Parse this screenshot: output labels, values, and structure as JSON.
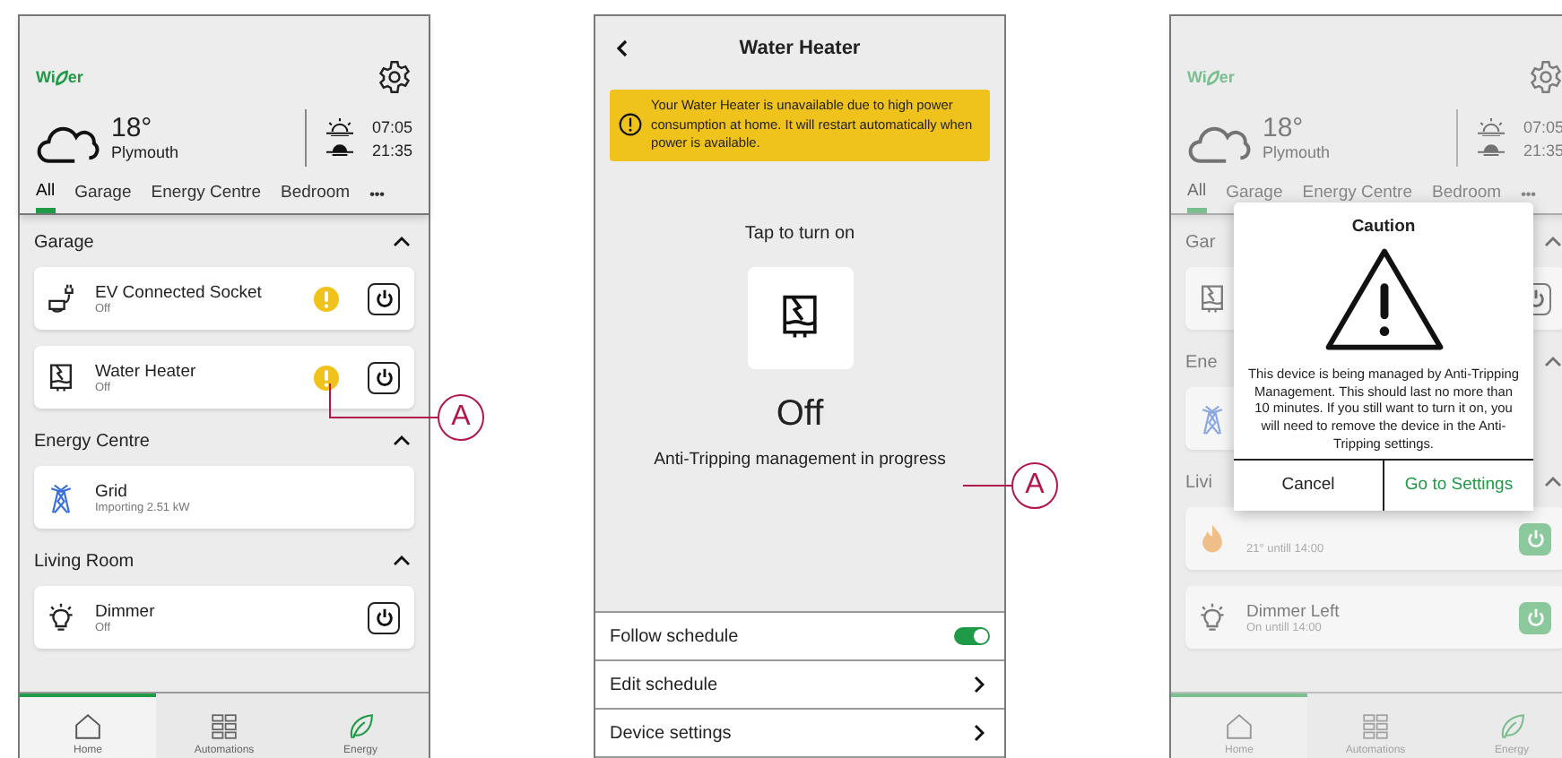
{
  "screens": [
    {
      "kind": "home",
      "dimmed": false,
      "logo": {
        "before": "Wi",
        "after": "er"
      },
      "weather": {
        "temperature": "18°",
        "city": "Plymouth",
        "sunrise": "07:05",
        "sunset": "21:35"
      },
      "tabs": [
        {
          "label": "All",
          "selected": true
        },
        {
          "label": "Garage",
          "selected": false
        },
        {
          "label": "Energy Centre",
          "selected": false
        },
        {
          "label": "Bedroom",
          "selected": false
        }
      ],
      "more": "•••",
      "sections": [
        {
          "title": "Garage",
          "expanded": true,
          "devices": [
            {
              "kind": "socket",
              "name": "EV Connected Socket",
              "status": "Off",
              "warning": true,
              "on": false
            },
            {
              "kind": "heater",
              "name": "Water Heater",
              "status": "Off",
              "warning": true,
              "on": false
            }
          ]
        },
        {
          "title": "Energy Centre",
          "expanded": true,
          "devices": [
            {
              "kind": "grid",
              "name": "Grid",
              "status": "Importing 2.51 kW",
              "warning": false
            }
          ]
        },
        {
          "title": "Living Room",
          "expanded": true,
          "devices": [
            {
              "kind": "light",
              "name": "Dimmer",
              "status": "Off",
              "warning": false,
              "on": false
            }
          ]
        }
      ],
      "nav": [
        {
          "kind": "home",
          "label": "Home",
          "selected": true
        },
        {
          "kind": "automations",
          "label": "Automations",
          "selected": false
        },
        {
          "kind": "energy",
          "label": "Energy",
          "selected": false
        }
      ]
    },
    {
      "kind": "device",
      "title": "Water Heater",
      "banner": "Your Water Heater is unavailable due to high power consumption at home. It will restart automatically when power is available.",
      "prompt": "Tap to turn on",
      "state": "Off",
      "note": "Anti-Tripping management in progress",
      "settings": [
        {
          "kind": "toggle",
          "label": "Follow schedule",
          "on": true
        },
        {
          "kind": "link",
          "label": "Edit schedule"
        },
        {
          "kind": "link",
          "label": "Device settings"
        }
      ]
    },
    {
      "kind": "home",
      "dimmed": true,
      "logo": {
        "before": "Wi",
        "after": "er"
      },
      "weather": {
        "temperature": "18°",
        "city": "Plymouth",
        "sunrise": "07:05",
        "sunset": "21:35"
      },
      "tabs": [
        {
          "label": "All",
          "selected": true
        },
        {
          "label": "Garage",
          "selected": false
        },
        {
          "label": "Energy Centre",
          "selected": false
        },
        {
          "label": "Bedroom",
          "selected": false
        }
      ],
      "more": "•••",
      "sections": [
        {
          "title": "Gar",
          "expanded": true,
          "devices": [
            {
              "kind": "heater",
              "warning": false,
              "on": false
            }
          ]
        },
        {
          "title": "Ene",
          "expanded": true,
          "devices": [
            {
              "kind": "grid",
              "warning": false
            }
          ]
        },
        {
          "title": "Livi",
          "expanded": true,
          "devices": [
            {
              "kind": "thermostat",
              "status": "21° untill 14:00",
              "warning": false,
              "on": true
            },
            {
              "kind": "light",
              "name": "Dimmer Left",
              "status": "On untill 14:00",
              "warning": false,
              "on": true
            }
          ]
        }
      ],
      "nav": [
        {
          "kind": "home",
          "label": "Home",
          "selected": true
        },
        {
          "kind": "automations",
          "label": "Automations",
          "selected": false
        },
        {
          "kind": "energy",
          "label": "Energy",
          "selected": false
        }
      ],
      "dialog": {
        "title": "Caution",
        "message": "This device is being managed by Anti-Tripping Management. This should last no more than 10 minutes. If you still want to turn it on, you will need to remove the device in the Anti-Tripping settings.",
        "buttons": [
          {
            "kind": "cancel",
            "label": "Cancel"
          },
          {
            "kind": "primary",
            "label": "Go to Settings"
          }
        ]
      }
    }
  ],
  "callouts": [
    {
      "label": "A"
    },
    {
      "label": "A"
    }
  ]
}
